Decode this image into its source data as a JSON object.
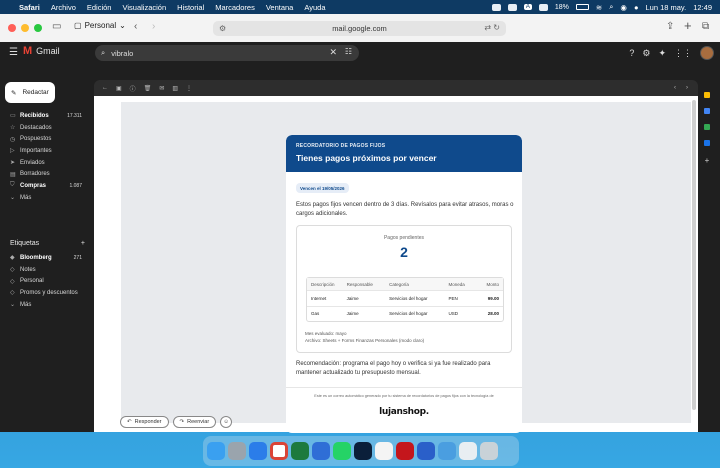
{
  "menubar": {
    "apple": "",
    "app": "Safari",
    "items": [
      "Archivo",
      "Edición",
      "Visualización",
      "Historial",
      "Marcadores",
      "Ventana",
      "Ayuda"
    ],
    "battery": "18%",
    "keyboard": "A",
    "datetime": "Lun 18 may.",
    "time": "12:49"
  },
  "safari": {
    "profile": "Personal",
    "url": "mail.google.com"
  },
  "gmail": {
    "brand": "Gmail",
    "search_value": "vibralo",
    "compose": "Redactar",
    "nav": [
      {
        "label": "Recibidos",
        "count": "17.311",
        "icon": "inbox-icon",
        "bold": true
      },
      {
        "label": "Destacados",
        "count": "",
        "icon": "star-icon",
        "bold": false
      },
      {
        "label": "Pospuestos",
        "count": "",
        "icon": "clock-icon",
        "bold": false
      },
      {
        "label": "Importantes",
        "count": "",
        "icon": "important-icon",
        "bold": false
      },
      {
        "label": "Enviados",
        "count": "",
        "icon": "send-icon",
        "bold": false
      },
      {
        "label": "Borradores",
        "count": "",
        "icon": "draft-icon",
        "bold": false
      },
      {
        "label": "Compras",
        "count": "1.087",
        "icon": "cart-icon",
        "bold": true
      },
      {
        "label": "Más",
        "count": "",
        "icon": "chevron-down-icon",
        "bold": false
      }
    ],
    "labels_title": "Etiquetas",
    "labels": [
      {
        "label": "Bloomberg",
        "count": "271",
        "bold": true
      },
      {
        "label": "Notes",
        "count": "",
        "bold": false
      },
      {
        "label": "Personal",
        "count": "",
        "bold": false
      },
      {
        "label": "Promos y descuentos",
        "count": "",
        "bold": false
      },
      {
        "label": "Más",
        "count": "",
        "bold": false
      }
    ]
  },
  "email": {
    "kicker": "RECORDATORIO DE PAGOS FIJOS",
    "title": "Tienes pagos próximos por vencer",
    "due_pill": "Vencen el 19/05/2026",
    "intro": "Estos pagos fijos vencen dentro de 3 días. Revísalos para evitar atrasos, moras o cargos adicionales.",
    "pending_label": "Pagos pendientes",
    "pending_count": "2",
    "table": {
      "headers": [
        "Descripción",
        "Responsable",
        "Categoría",
        "Moneda",
        "Monto"
      ],
      "rows": [
        [
          "Internet",
          "Jaime",
          "Servicios del hogar",
          "PEN",
          "99.00"
        ],
        [
          "Gas",
          "Jaime",
          "Servicios del hogar",
          "USD",
          "28.00"
        ]
      ]
    },
    "meta_month": "Mes evaluado: mayo",
    "meta_file": "Archivo: Sheets + Forms Finanzas Personales (modo claro)",
    "recommendation": "Recomendación: programa el pago hoy o verifica si ya fue realizado para mantener actualizado tu presupuesto mensual.",
    "footer": "Este es un correo automático generado por tu sistema de recordatorios de pagos fijos con la tecnología de",
    "brand_logo": "lujanshop."
  },
  "actions": {
    "reply": "Responder",
    "forward": "Reenviar"
  },
  "colors": {
    "header_blue": "#0f4a8c",
    "gmail_dark": "#1f1f1f"
  }
}
